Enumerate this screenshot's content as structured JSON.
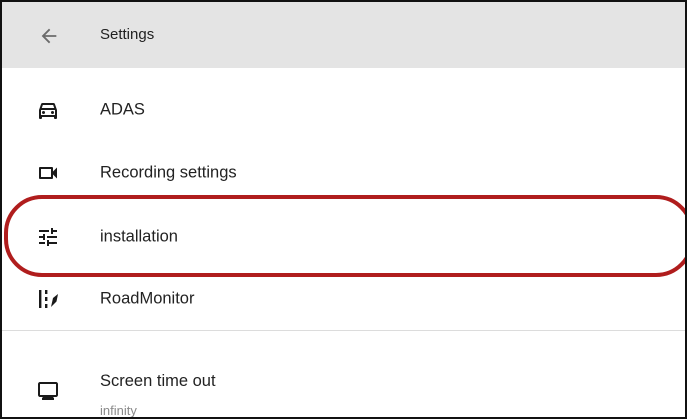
{
  "appbar": {
    "back_icon": "arrow-left-icon",
    "title": "Settings"
  },
  "items": [
    {
      "icon": "car-icon",
      "label": "ADAS"
    },
    {
      "icon": "videocam-icon",
      "label": "Recording settings"
    },
    {
      "icon": "tune-sliders-icon",
      "label": "installation"
    },
    {
      "icon": "road-icon",
      "label": "RoadMonitor"
    }
  ],
  "screen_timeout": {
    "icon": "monitor-icon",
    "label": "Screen time out",
    "value": "infinity"
  },
  "colors": {
    "appbar_bg": "#e4e4e4",
    "highlight": "#b01d1d",
    "text": "#222222",
    "subtext": "#8a8a8a"
  }
}
